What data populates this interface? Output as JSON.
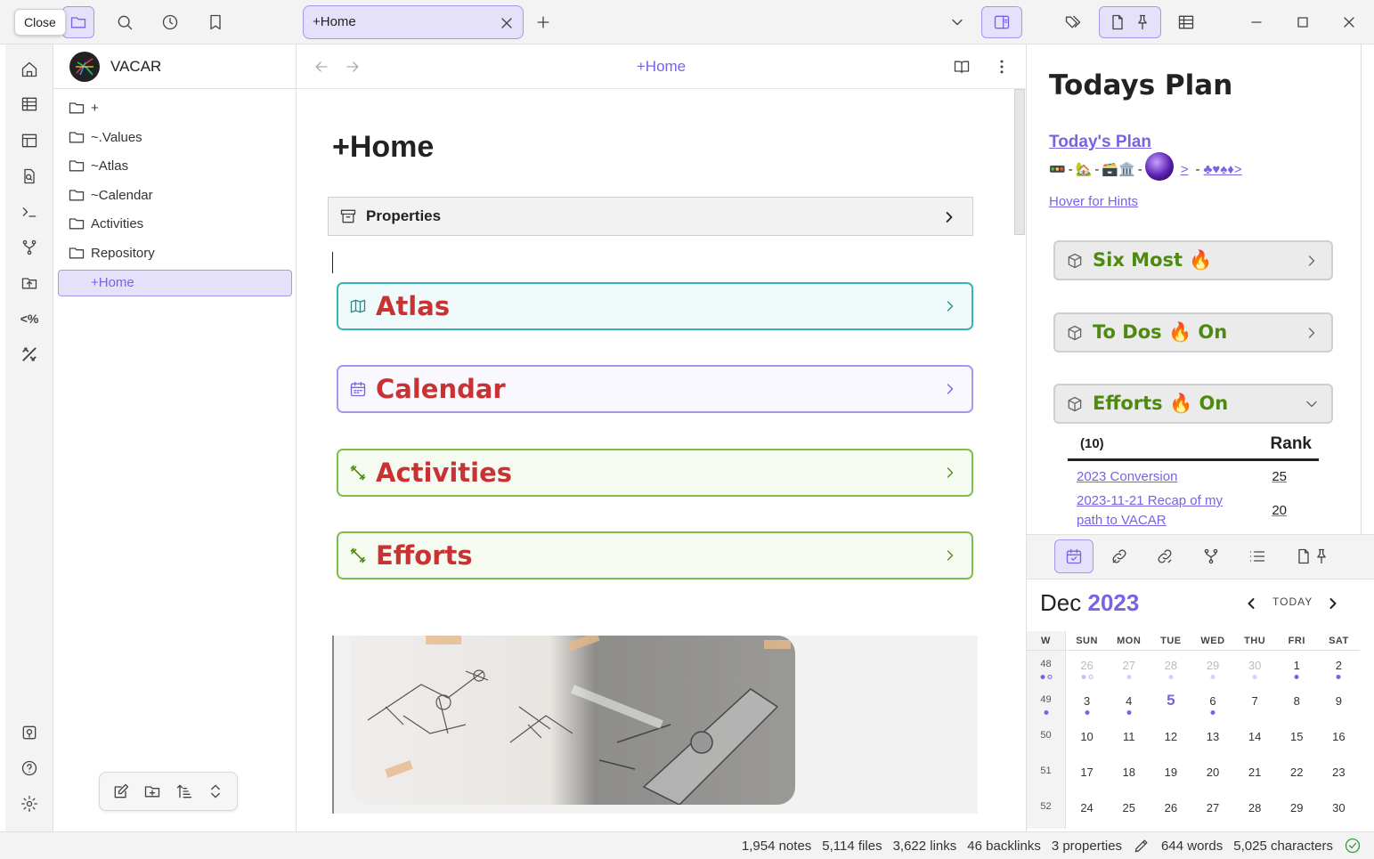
{
  "topbar": {
    "close_tooltip": "Close",
    "tab_label": "+Home"
  },
  "filepane": {
    "vault_name": "VACAR",
    "folders": [
      "+",
      "~.Values",
      "~Atlas",
      "~Calendar",
      "Activities",
      "Repository"
    ],
    "active_note": "+Home"
  },
  "editor": {
    "header_title": "+Home",
    "heading": "+Home",
    "properties_label": "Properties",
    "callouts": [
      {
        "label": "Atlas",
        "icon": "map-icon"
      },
      {
        "label": "Calendar",
        "icon": "calendar-icon"
      },
      {
        "label": "Activities",
        "icon": "dumbbell-icon"
      },
      {
        "label": "Efforts",
        "icon": "dumbbell-icon"
      }
    ]
  },
  "right": {
    "title": "Todays Plan",
    "plan_link": "Today's Plan",
    "emoji_row": [
      "🚥",
      "-",
      "🏡",
      "-",
      "🗃️🏛️",
      "-"
    ],
    "emoji_tail": [
      ">",
      "-",
      "♣♥♠♦>"
    ],
    "hint": "Hover for Hints",
    "callouts": [
      {
        "label": "Six Most 🔥",
        "state": "collapsed"
      },
      {
        "label": "To Dos 🔥 On",
        "state": "collapsed"
      },
      {
        "label": "Efforts 🔥 On",
        "state": "expanded"
      }
    ],
    "efforts_table": {
      "count": "(10)",
      "rank_header": "Rank",
      "rows": [
        {
          "name": "2023 Conversion",
          "rank": "25"
        },
        {
          "name": "2023-11-21  Recap of my path to VACAR",
          "rank": "20"
        }
      ]
    }
  },
  "calendar": {
    "month": "Dec",
    "year": "2023",
    "today_label": "TODAY",
    "weekday_headers": [
      "W",
      "SUN",
      "MON",
      "TUE",
      "WED",
      "THU",
      "FRI",
      "SAT"
    ],
    "weeks": [
      {
        "w": "48",
        "days": [
          "26",
          "27",
          "28",
          "29",
          "30",
          "1",
          "2"
        ]
      },
      {
        "w": "49",
        "days": [
          "3",
          "4",
          "5",
          "6",
          "7",
          "8",
          "9"
        ]
      },
      {
        "w": "50",
        "days": [
          "10",
          "11",
          "12",
          "13",
          "14",
          "15",
          "16"
        ]
      },
      {
        "w": "51",
        "days": [
          "17",
          "18",
          "19",
          "20",
          "21",
          "22",
          "23"
        ]
      },
      {
        "w": "52",
        "days": [
          "24",
          "25",
          "26",
          "27",
          "28",
          "29",
          "30"
        ]
      }
    ],
    "current_day": "5"
  },
  "status": {
    "notes": "1,954 notes",
    "files": "5,114 files",
    "links": "3,622 links",
    "backlinks": "46 backlinks",
    "properties": "3 properties",
    "words": "644 words",
    "characters": "5,025 characters"
  },
  "colors": {
    "accent": "#7b61e4",
    "callout_title": "#c83232",
    "green_title": "#4f8a10"
  }
}
